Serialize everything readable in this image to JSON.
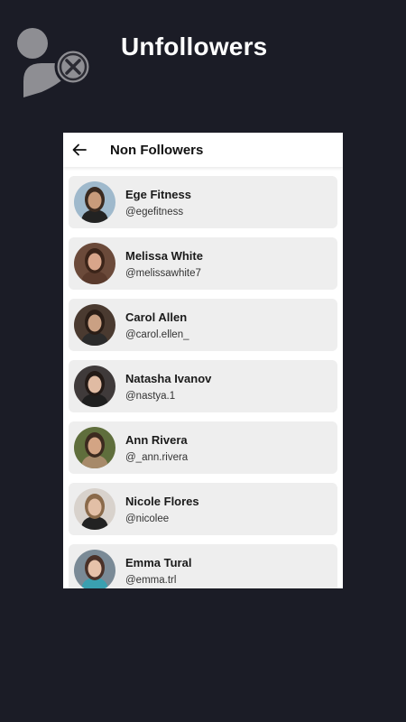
{
  "promo": {
    "title": "Unfollowers"
  },
  "appbar": {
    "title": "Non Followers"
  },
  "users": [
    {
      "name": "Ege Fitness",
      "handle": "@egefitness",
      "bg": "#9fb9cc",
      "hair": "#3a2a20",
      "skin": "#c89b7b",
      "shirt": "#222222"
    },
    {
      "name": "Melissa White",
      "handle": "@melissawhite7",
      "bg": "#6b4a3a",
      "hair": "#3b2419",
      "skin": "#d8a58a",
      "shirt": "#5a3a2c"
    },
    {
      "name": "Carol Allen",
      "handle": "@carol.ellen_",
      "bg": "#4a3a30",
      "hair": "#2a1d16",
      "skin": "#caa083",
      "shirt": "#2b2b2b"
    },
    {
      "name": "Natasha Ivanov",
      "handle": "@nastya.1",
      "bg": "#3f3a3a",
      "hair": "#231a16",
      "skin": "#e0bba3",
      "shirt": "#1f1f1f"
    },
    {
      "name": "Ann Rivera",
      "handle": "@_ann.rivera",
      "bg": "#5f6e3c",
      "hair": "#3c2a1f",
      "skin": "#d3a484",
      "shirt": "#a78a6a"
    },
    {
      "name": "Nicole Flores",
      "handle": "@nicolee",
      "bg": "#d8d2cc",
      "hair": "#8a6a4a",
      "skin": "#e2bfa6",
      "shirt": "#222222"
    },
    {
      "name": "Emma Tural",
      "handle": "@emma.trl",
      "bg": "#7a8a96",
      "hair": "#4a3128",
      "skin": "#e6c2aa",
      "shirt": "#3aa0b0"
    }
  ]
}
